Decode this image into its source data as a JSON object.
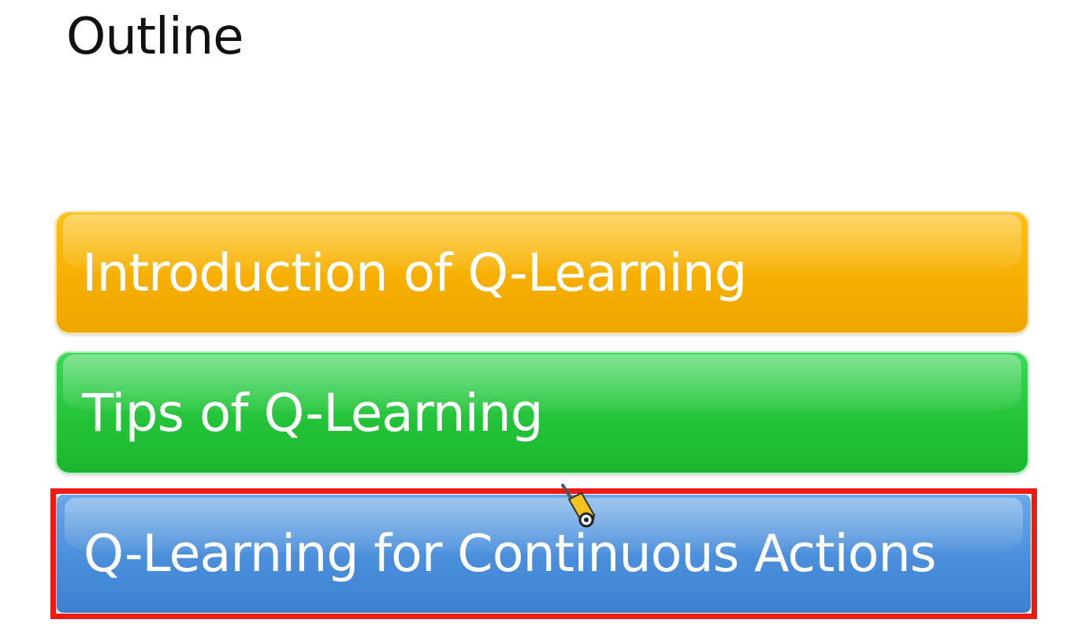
{
  "slide": {
    "title": "Outline",
    "items": [
      {
        "label": "Introduction of Q-Learning",
        "color": "#f5ad00"
      },
      {
        "label": "Tips of Q-Learning",
        "color": "#22c237"
      },
      {
        "label": "Q-Learning for Continuous Actions",
        "color": "#4a8edb",
        "highlighted": true,
        "highlight_color": "#ee1a14"
      }
    ]
  },
  "cursor": {
    "icon": "pencil-cursor-icon"
  }
}
